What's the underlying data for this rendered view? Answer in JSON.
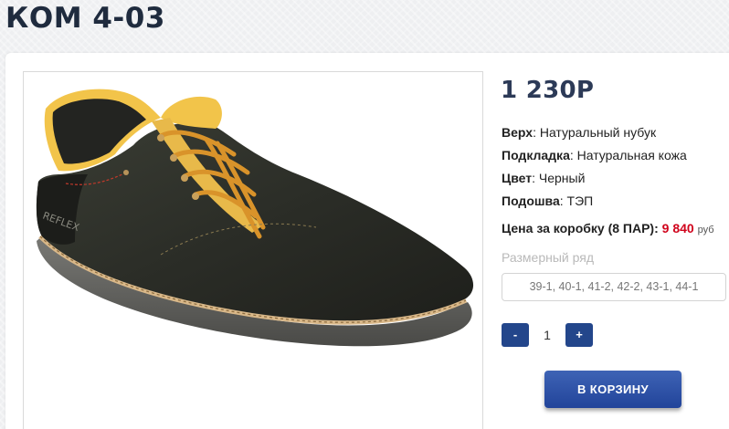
{
  "product": {
    "title": "КОМ 4-03",
    "price": "1 230Р",
    "attributes": [
      {
        "label": "Верх",
        "value": "Натуральный нубук"
      },
      {
        "label": "Подкладка",
        "value": "Натуральная кожа"
      },
      {
        "label": "Цвет",
        "value": "Черный"
      },
      {
        "label": "Подошва",
        "value": "ТЭП"
      }
    ],
    "box_price": {
      "label": "Цена за коробку (8 ПАР):",
      "value": "9 840",
      "currency": "руб"
    },
    "size_label": "Размерный ряд",
    "sizes": "39-1, 40-1, 41-2, 42-2, 43-1, 44-1",
    "quantity": {
      "minus": "-",
      "value": "1",
      "plus": "+"
    },
    "cart_button": "В КОРЗИНУ",
    "image_brand_text": "REFLEX"
  },
  "colors": {
    "accent": "#23468b",
    "price_red": "#d0021b",
    "title": "#1f2b3e"
  }
}
